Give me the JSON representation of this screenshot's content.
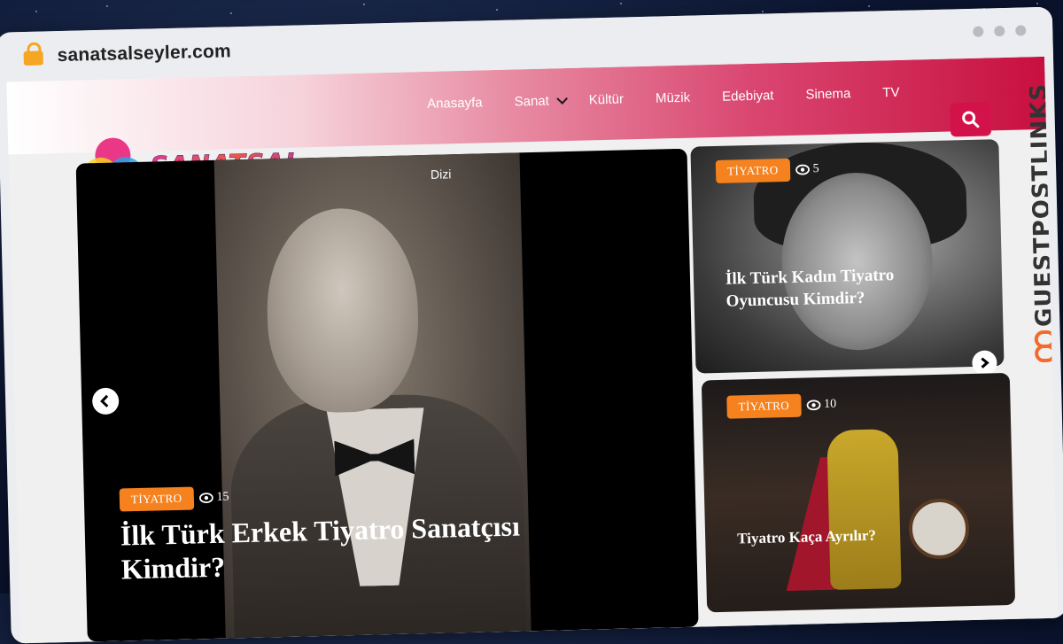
{
  "browser": {
    "url": "sanatsalseyler.com"
  },
  "site": {
    "logo_text": "SANATSAL ŞEYLER",
    "nav": {
      "items": [
        "Anasayfa",
        "Sanat",
        "Kültür",
        "Müzik",
        "Edebiyat",
        "Sinema",
        "TV"
      ],
      "overflow_item": "Dizi"
    },
    "search_icon": "search-icon"
  },
  "featured": {
    "tag": "TİYATRO",
    "views": "15",
    "title": "İlk Türk Erkek Tiyatro Sanatçısı Kimdir?"
  },
  "side_posts": [
    {
      "tag": "TİYATRO",
      "views": "5",
      "title": "İlk Türk Kadın Tiyatro Oyuncusu Kimdir?"
    },
    {
      "tag": "TİYATRO",
      "views": "10",
      "title": "Tiyatro Kaça Ayrılır?"
    }
  ],
  "watermark": {
    "text": "GUESTPOSTLINKS"
  },
  "colors": {
    "accent": "#d3124a",
    "tag": "#f5821f",
    "header_end": "#c8103f"
  }
}
